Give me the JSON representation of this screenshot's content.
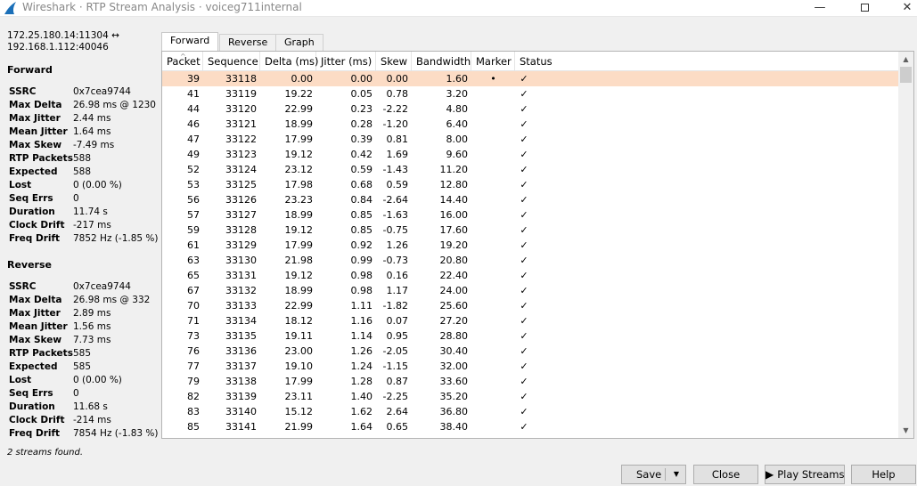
{
  "window": {
    "title": "Wireshark · RTP Stream Analysis · voiceg711internal",
    "minimize": "—",
    "close": "✕"
  },
  "summary": {
    "addr_line1": "172.25.180.14:11304 ↔",
    "addr_line2": "192.168.1.112:40046",
    "forward_title": "Forward",
    "reverse_title": "Reverse",
    "forward": [
      {
        "key": "SSRC",
        "value": "0x7cea9744"
      },
      {
        "key": "Max Delta",
        "value": "26.98 ms @ 1230"
      },
      {
        "key": "Max Jitter",
        "value": "2.44 ms"
      },
      {
        "key": "Mean Jitter",
        "value": "1.64 ms"
      },
      {
        "key": "Max Skew",
        "value": "-7.49 ms"
      },
      {
        "key": "RTP Packets",
        "value": "588"
      },
      {
        "key": "Expected",
        "value": "588"
      },
      {
        "key": "Lost",
        "value": "0 (0.00 %)"
      },
      {
        "key": "Seq Errs",
        "value": "0"
      },
      {
        "key": "Duration",
        "value": "11.74 s"
      },
      {
        "key": "Clock Drift",
        "value": "-217 ms"
      },
      {
        "key": "Freq Drift",
        "value": "7852 Hz (-1.85 %)"
      }
    ],
    "reverse": [
      {
        "key": "SSRC",
        "value": "0x7cea9744"
      },
      {
        "key": "Max Delta",
        "value": "26.98 ms @ 332"
      },
      {
        "key": "Max Jitter",
        "value": "2.89 ms"
      },
      {
        "key": "Mean Jitter",
        "value": "1.56 ms"
      },
      {
        "key": "Max Skew",
        "value": "7.73 ms"
      },
      {
        "key": "RTP Packets",
        "value": "585"
      },
      {
        "key": "Expected",
        "value": "585"
      },
      {
        "key": "Lost",
        "value": "0 (0.00 %)"
      },
      {
        "key": "Seq Errs",
        "value": "0"
      },
      {
        "key": "Duration",
        "value": "11.68 s"
      },
      {
        "key": "Clock Drift",
        "value": "-214 ms"
      },
      {
        "key": "Freq Drift",
        "value": "7854 Hz (-1.83 %)"
      }
    ],
    "status": "2 streams found."
  },
  "tabs": [
    "Forward",
    "Reverse",
    "Graph"
  ],
  "active_tab": 0,
  "table": {
    "columns": [
      "Packet",
      "Sequence",
      "Delta (ms)",
      "Jitter (ms)",
      "Skew",
      "Bandwidth",
      "Marker",
      "Status"
    ],
    "selected_row": 0,
    "rows": [
      [
        "39",
        "33118",
        "0.00",
        "0.00",
        "0.00",
        "1.60",
        "•",
        "✓"
      ],
      [
        "41",
        "33119",
        "19.22",
        "0.05",
        "0.78",
        "3.20",
        "",
        "✓"
      ],
      [
        "44",
        "33120",
        "22.99",
        "0.23",
        "-2.22",
        "4.80",
        "",
        "✓"
      ],
      [
        "46",
        "33121",
        "18.99",
        "0.28",
        "-1.20",
        "6.40",
        "",
        "✓"
      ],
      [
        "47",
        "33122",
        "17.99",
        "0.39",
        "0.81",
        "8.00",
        "",
        "✓"
      ],
      [
        "49",
        "33123",
        "19.12",
        "0.42",
        "1.69",
        "9.60",
        "",
        "✓"
      ],
      [
        "52",
        "33124",
        "23.12",
        "0.59",
        "-1.43",
        "11.20",
        "",
        "✓"
      ],
      [
        "53",
        "33125",
        "17.98",
        "0.68",
        "0.59",
        "12.80",
        "",
        "✓"
      ],
      [
        "56",
        "33126",
        "23.23",
        "0.84",
        "-2.64",
        "14.40",
        "",
        "✓"
      ],
      [
        "57",
        "33127",
        "18.99",
        "0.85",
        "-1.63",
        "16.00",
        "",
        "✓"
      ],
      [
        "59",
        "33128",
        "19.12",
        "0.85",
        "-0.75",
        "17.60",
        "",
        "✓"
      ],
      [
        "61",
        "33129",
        "17.99",
        "0.92",
        "1.26",
        "19.20",
        "",
        "✓"
      ],
      [
        "63",
        "33130",
        "21.98",
        "0.99",
        "-0.73",
        "20.80",
        "",
        "✓"
      ],
      [
        "65",
        "33131",
        "19.12",
        "0.98",
        "0.16",
        "22.40",
        "",
        "✓"
      ],
      [
        "67",
        "33132",
        "18.99",
        "0.98",
        "1.17",
        "24.00",
        "",
        "✓"
      ],
      [
        "70",
        "33133",
        "22.99",
        "1.11",
        "-1.82",
        "25.60",
        "",
        "✓"
      ],
      [
        "71",
        "33134",
        "18.12",
        "1.16",
        "0.07",
        "27.20",
        "",
        "✓"
      ],
      [
        "73",
        "33135",
        "19.11",
        "1.14",
        "0.95",
        "28.80",
        "",
        "✓"
      ],
      [
        "76",
        "33136",
        "23.00",
        "1.26",
        "-2.05",
        "30.40",
        "",
        "✓"
      ],
      [
        "77",
        "33137",
        "19.10",
        "1.24",
        "-1.15",
        "32.00",
        "",
        "✓"
      ],
      [
        "79",
        "33138",
        "17.99",
        "1.28",
        "0.87",
        "33.60",
        "",
        "✓"
      ],
      [
        "82",
        "33139",
        "23.11",
        "1.40",
        "-2.25",
        "35.20",
        "",
        "✓"
      ],
      [
        "83",
        "33140",
        "15.12",
        "1.62",
        "2.64",
        "36.80",
        "",
        "✓"
      ],
      [
        "85",
        "33141",
        "21.99",
        "1.64",
        "0.65",
        "38.40",
        "",
        "✓"
      ]
    ]
  },
  "buttons": {
    "save": "Save",
    "close": "Close",
    "play_streams": "Play Streams",
    "help": "Help"
  },
  "colors": {
    "selected_row": "#fcdcc5",
    "app_icon": "#1a6fb8"
  }
}
